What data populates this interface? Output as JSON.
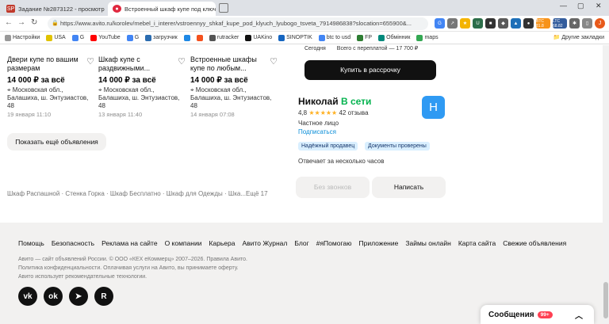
{
  "browser": {
    "tabs": [
      {
        "icon": "SP",
        "title": "Задание №2873122 - просмотр з"
      },
      {
        "icon": "avito-icon",
        "title": "Встроенный шкаф купе под ключ"
      }
    ],
    "url": "https://www.avito.ru/korolev/mebel_i_interer/vstroennyy_shkaf_kupe_pod_klyuch_lyubogo_tsveta_7914986838?slocation=655900&...",
    "bookmarks": [
      "Настройки",
      "USA",
      "G",
      "YouTube",
      "G",
      "загрузчик",
      "B",
      "F",
      "rutracker",
      "UAKino",
      "SINOPTIK",
      "btc to usd",
      "FP",
      "Обмінник",
      "maps"
    ],
    "other_bookmarks": "Другие закладки",
    "ext_badges": [
      "LTC 68.82",
      "BTC 81.8"
    ]
  },
  "listings": [
    {
      "title": "Двери купе по вашим размерам",
      "price": "14 000 ₽ за всё",
      "location": "Московская обл., Балашиха, ш. Энтузиастов, 48",
      "date": "19 января 11:10"
    },
    {
      "title": "Шкаф купе с раздвижными...",
      "price": "14 000 ₽ за всё",
      "location": "Московская обл., Балашиха, ш. Энтузиастов, 48",
      "date": "13 января 11:40"
    },
    {
      "title": "Встроенные шкафы купе по любым...",
      "price": "14 000 ₽ за всё",
      "location": "Московская обл., Балашиха, ш. Энтузиастов, 48",
      "date": "14 января 07:08"
    }
  ],
  "show_more_label": "Показать ещё объявления",
  "related_links": "Шкаф Распашной · Стенка Горка · Шкаф Бесплатно · Шкаф для Одежды · Шка...Ещё 17",
  "purchase": {
    "today_label": "Сегодня",
    "total_label": "Всего с переплатой — 17 700 ₽",
    "buy_button": "Купить в рассрочку"
  },
  "seller": {
    "name": "Николай",
    "online": "В сети",
    "rating": "4,8",
    "stars": "★★★★★",
    "reviews": "42 отзыва",
    "type": "Частное лицо",
    "subscribe": "Подписаться",
    "avatar_letter": "Н",
    "badges": [
      "Надёжный продавец",
      "Документы проверены"
    ],
    "reply_time": "Отвечает за несколько часов",
    "no_calls_label": "Без звонков",
    "write_label": "Написать"
  },
  "footer": {
    "links": [
      "Помощь",
      "Безопасность",
      "Реклама на сайте",
      "О компании",
      "Карьера",
      "Авито Журнал",
      "Блог",
      "#яПомогаю",
      "Приложение",
      "Займы онлайн",
      "Карта сайта",
      "Свежие объявления"
    ],
    "legal_1": "Авито — сайт объявлений России. © ООО «КЕХ еКоммерц» 2007–2026. Правила Авито.",
    "legal_2": "Политика конфиденциальности. Оплачивая услуги на Авито, вы принимаете оферту.",
    "legal_3": "Авито использует рекомендательные технологии.",
    "socials": [
      "vk-icon",
      "ok-icon",
      "telegram-icon",
      "rutube-icon"
    ]
  },
  "messages": {
    "label": "Сообщения",
    "count": "99+"
  },
  "colors": {
    "accent_green": "#04b34f",
    "link_blue": "#0a8ed8",
    "avatar_blue": "#2f9af3",
    "badge_red": "#ff4053"
  }
}
